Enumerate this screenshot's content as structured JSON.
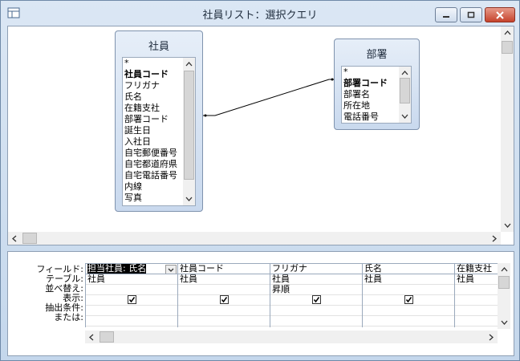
{
  "window": {
    "title": "社員リスト：選択クエリ"
  },
  "tables": [
    {
      "name": "社員",
      "fields": [
        {
          "label": "*",
          "pk": false
        },
        {
          "label": "社員コード",
          "pk": true
        },
        {
          "label": "フリガナ",
          "pk": false
        },
        {
          "label": "氏名",
          "pk": false
        },
        {
          "label": "在籍支社",
          "pk": false
        },
        {
          "label": "部署コード",
          "pk": false
        },
        {
          "label": "誕生日",
          "pk": false
        },
        {
          "label": "入社日",
          "pk": false
        },
        {
          "label": "自宅郵便番号",
          "pk": false
        },
        {
          "label": "自宅都道府県",
          "pk": false
        },
        {
          "label": "自宅電話番号",
          "pk": false
        },
        {
          "label": "内線",
          "pk": false
        },
        {
          "label": "写真",
          "pk": false
        }
      ]
    },
    {
      "name": "部署",
      "fields": [
        {
          "label": "*",
          "pk": false
        },
        {
          "label": "部署コード",
          "pk": true
        },
        {
          "label": "部署名",
          "pk": false
        },
        {
          "label": "所在地",
          "pk": false
        },
        {
          "label": "電話番号",
          "pk": false
        }
      ]
    }
  ],
  "grid": {
    "row_labels": [
      "フィールド:",
      "テーブル:",
      "並べ替え:",
      "表示:",
      "抽出条件:",
      "または:"
    ],
    "columns": [
      {
        "field": "担当社員: 氏名",
        "table": "社員",
        "sort": "",
        "show": true,
        "selected": true
      },
      {
        "field": "社員コード",
        "table": "社員",
        "sort": "",
        "show": true,
        "selected": false
      },
      {
        "field": "フリガナ",
        "table": "社員",
        "sort": "昇順",
        "show": true,
        "selected": false
      },
      {
        "field": "氏名",
        "table": "社員",
        "sort": "",
        "show": true,
        "selected": false
      },
      {
        "field": "在籍支社",
        "table": "社員",
        "sort": "",
        "show": false,
        "selected": false
      }
    ]
  },
  "colors": {
    "accent": "#c6432c",
    "frame": "#b9d1ea"
  },
  "icons": [
    "query-icon",
    "minimize-icon",
    "maximize-icon",
    "close-icon",
    "dropdown-icon",
    "checkbox-icon"
  ]
}
